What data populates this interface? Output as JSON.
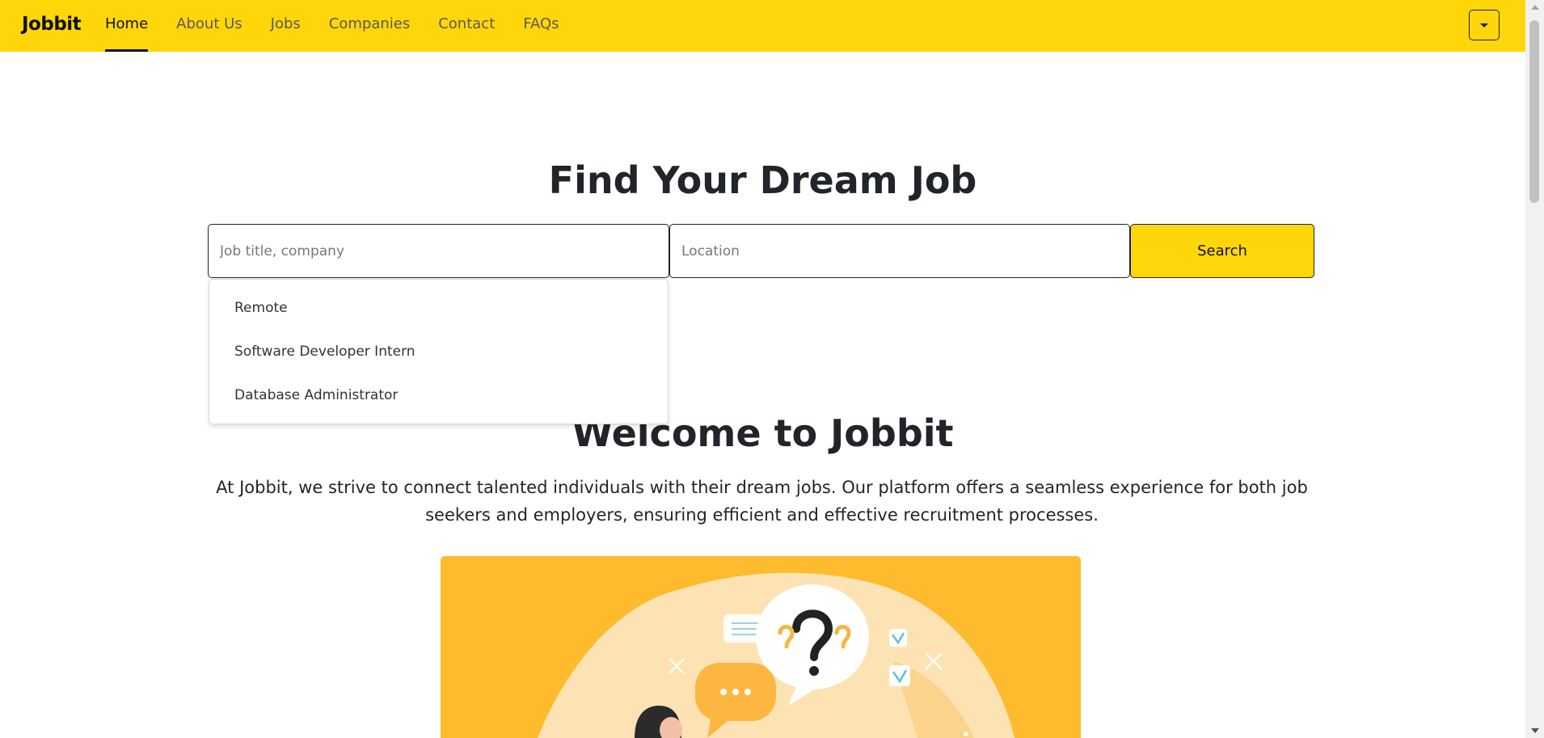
{
  "navbar": {
    "brand": "Jobbit",
    "links": [
      {
        "label": "Home",
        "active": true
      },
      {
        "label": "About Us",
        "active": false
      },
      {
        "label": "Jobs",
        "active": false
      },
      {
        "label": "Companies",
        "active": false
      },
      {
        "label": "Contact",
        "active": false
      },
      {
        "label": "FAQs",
        "active": false
      }
    ],
    "toggle_icon": "caret-down-icon",
    "background_color": "#ffd60a"
  },
  "hero": {
    "title": "Find Your Dream Job",
    "job_input": {
      "placeholder": "Job title, company",
      "value": ""
    },
    "location_input": {
      "placeholder": "Location",
      "value": ""
    },
    "search_label": "Search",
    "suggestions": [
      "Remote",
      "Software Developer Intern",
      "Database Administrator"
    ]
  },
  "welcome": {
    "title": "Welcome to Jobbit",
    "text": "At Jobbit, we strive to connect talented individuals with their dream jobs. Our platform offers a seamless experience for both job seekers and employers, ensuring efficient and effective recruitment processes.",
    "illustration_color": "#fdbb2d",
    "illustration_icon": "question-speech-bubble-icon"
  }
}
